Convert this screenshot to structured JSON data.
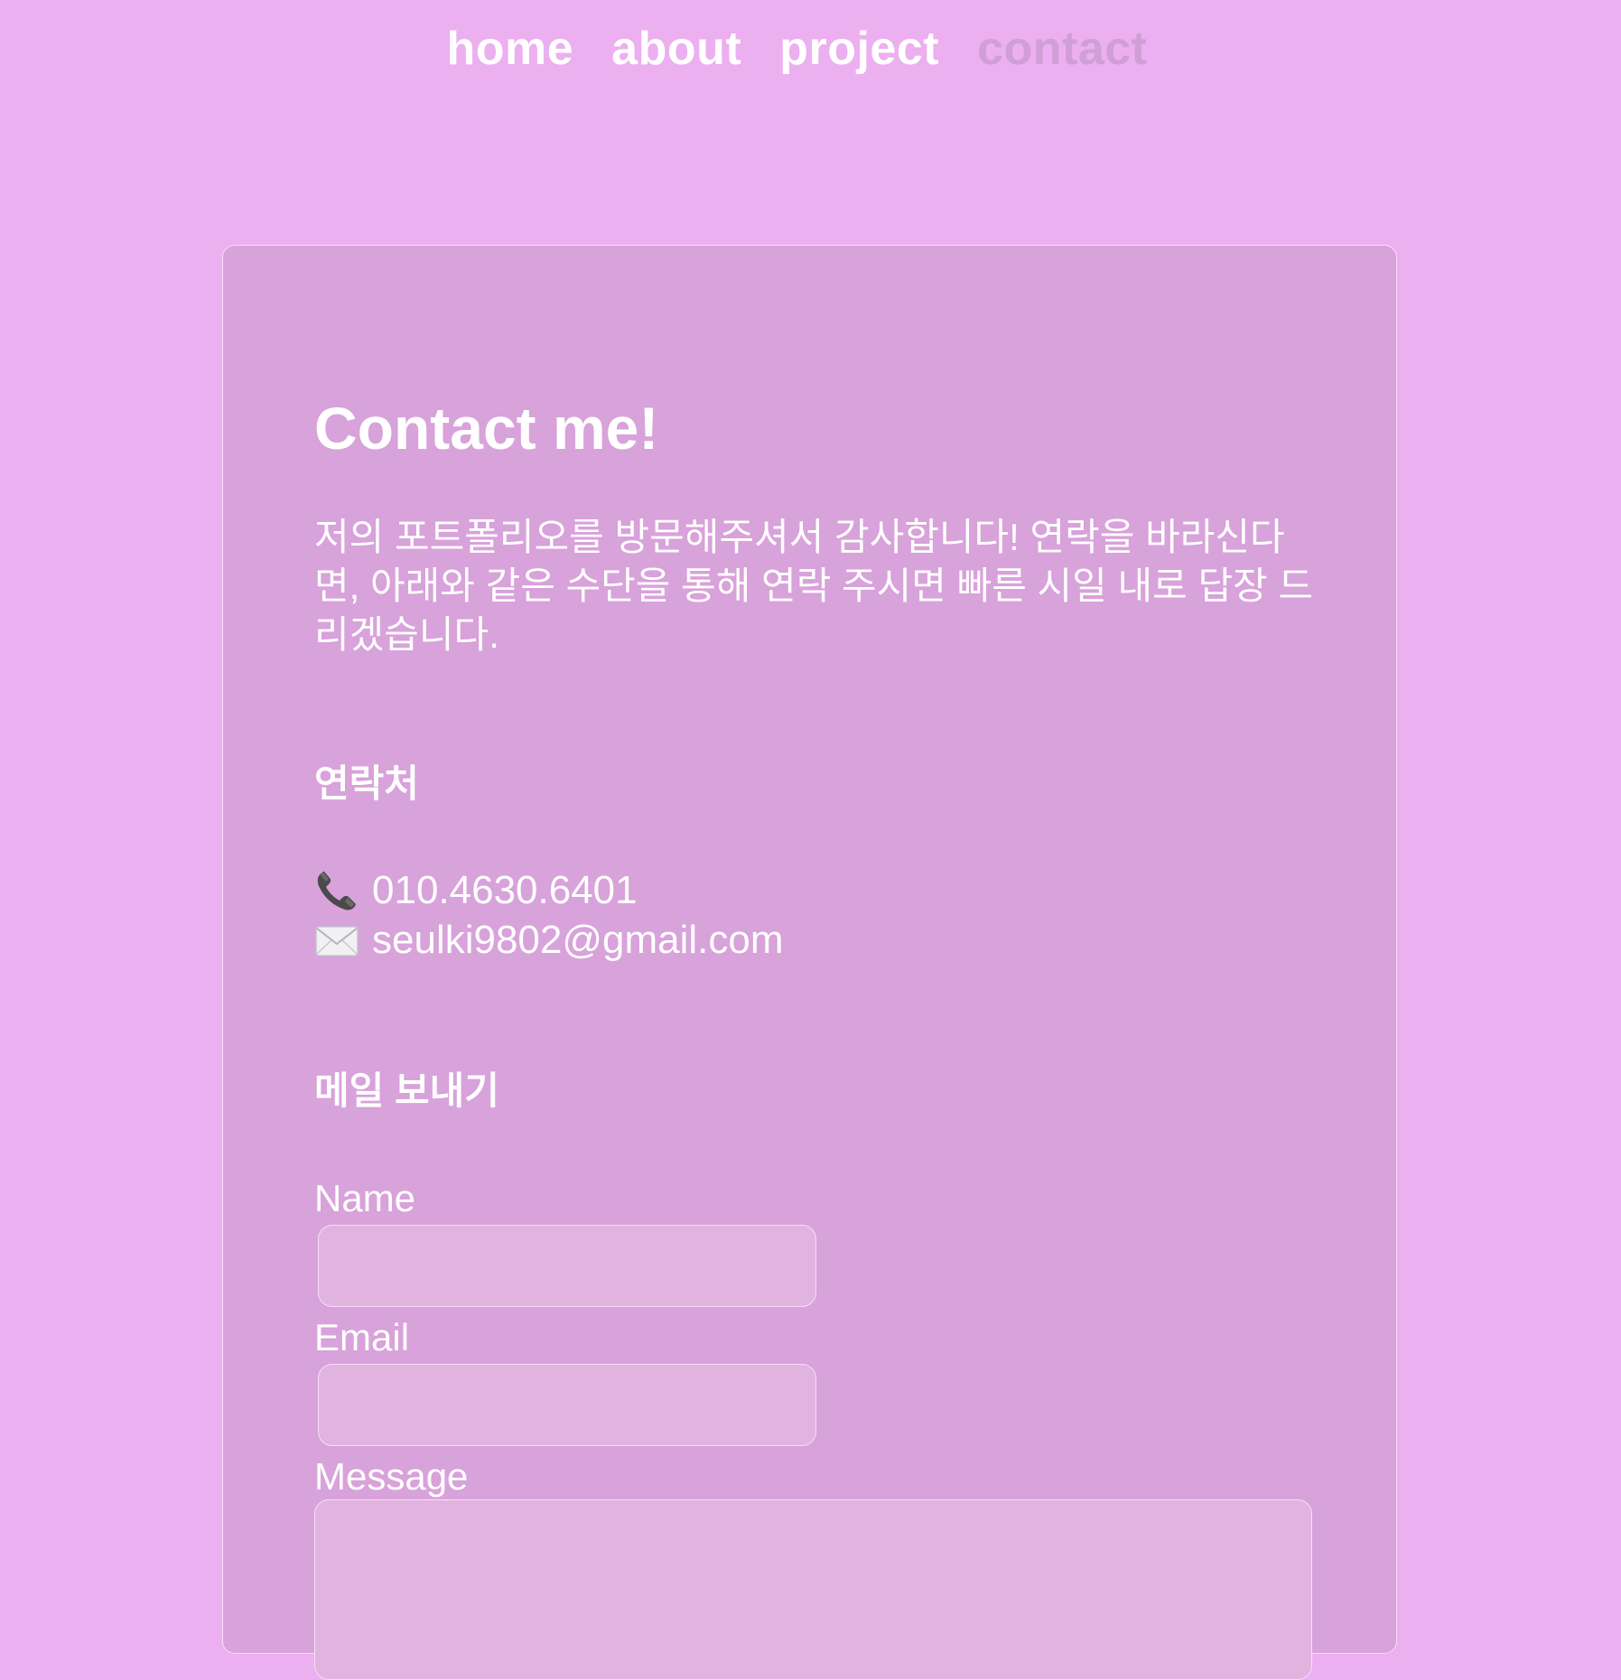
{
  "nav": {
    "items": [
      {
        "label": "home",
        "active": false
      },
      {
        "label": "about",
        "active": false
      },
      {
        "label": "project",
        "active": false
      },
      {
        "label": "contact",
        "active": true
      }
    ]
  },
  "card": {
    "title": "Contact me!",
    "intro": "저의 포트폴리오를 방문해주셔서 감사합니다! 연락을 바라신다면, 아래와 같은 수단을 통해 연락 주시면 빠른 시일 내로 답장 드리겠습니다.",
    "contact_heading": "연락처",
    "phone": {
      "icon": "telephone-icon",
      "value": "010.4630.6401"
    },
    "email": {
      "icon": "envelope-icon",
      "value": "seulki9802@gmail.com"
    },
    "mail_heading": "메일 보내기",
    "form": {
      "name_label": "Name",
      "name_value": "",
      "email_label": "Email",
      "email_value": "",
      "message_label": "Message",
      "message_value": ""
    }
  },
  "colors": {
    "background": "#ecaff0",
    "card": "#d8a2da",
    "input": "#e1b4e0",
    "nav_active": "#cf9fd6",
    "text": "#ffffff"
  }
}
